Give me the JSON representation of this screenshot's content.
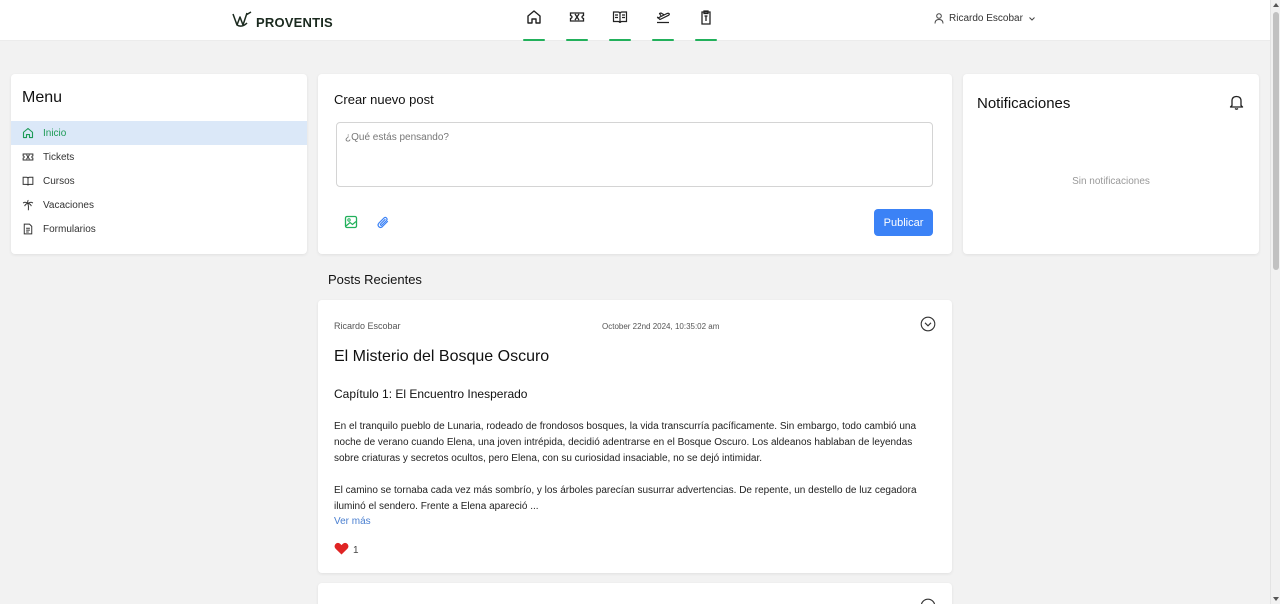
{
  "brand": {
    "name": "PROVENTIS",
    "accent": "#22b05b"
  },
  "topnav": {
    "items": [
      {
        "name": "home-icon"
      },
      {
        "name": "ticket-icon"
      },
      {
        "name": "book-icon"
      },
      {
        "name": "plane-icon"
      },
      {
        "name": "clipboard-icon"
      }
    ]
  },
  "user": {
    "name": "Ricardo Escobar"
  },
  "menu": {
    "title": "Menu",
    "items": [
      {
        "label": "Inicio",
        "icon": "home-icon",
        "active": true
      },
      {
        "label": "Tickets",
        "icon": "ticket-icon"
      },
      {
        "label": "Cursos",
        "icon": "book-icon"
      },
      {
        "label": "Vacaciones",
        "icon": "palm-tree-icon"
      },
      {
        "label": "Formularios",
        "icon": "document-icon"
      }
    ]
  },
  "create_post": {
    "title": "Crear nuevo post",
    "placeholder": "¿Qué estás pensando?",
    "value": "",
    "publish_label": "Publicar",
    "publish_color": "#3b82f6"
  },
  "notifications": {
    "title": "Notificaciones",
    "empty_text": "Sin notificaciones"
  },
  "recent": {
    "title": "Posts Recientes",
    "posts": [
      {
        "author": "Ricardo Escobar",
        "date": "October 22nd 2024, 10:35:02 am",
        "title": "El Misterio del Bosque Oscuro",
        "subtitle": "Capítulo 1: El Encuentro Inesperado",
        "paragraphs": [
          "En el tranquilo pueblo de Lunaria, rodeado de frondosos bosques, la vida transcurría pacíficamente. Sin embargo, todo cambió una noche de verano cuando Elena, una joven intrépida, decidió adentrarse en el Bosque Oscuro. Los aldeanos hablaban de leyendas sobre criaturas y secretos ocultos, pero Elena, con su curiosidad insaciable, no se dejó intimidar.",
          "El camino se tornaba cada vez más sombrío, y los árboles parecían susurrar advertencias. De repente, un destello de luz cegadora iluminó el sendero. Frente a Elena apareció ..."
        ],
        "read_more": "Ver más",
        "likes": "1",
        "heart_color": "#e02424"
      }
    ]
  }
}
